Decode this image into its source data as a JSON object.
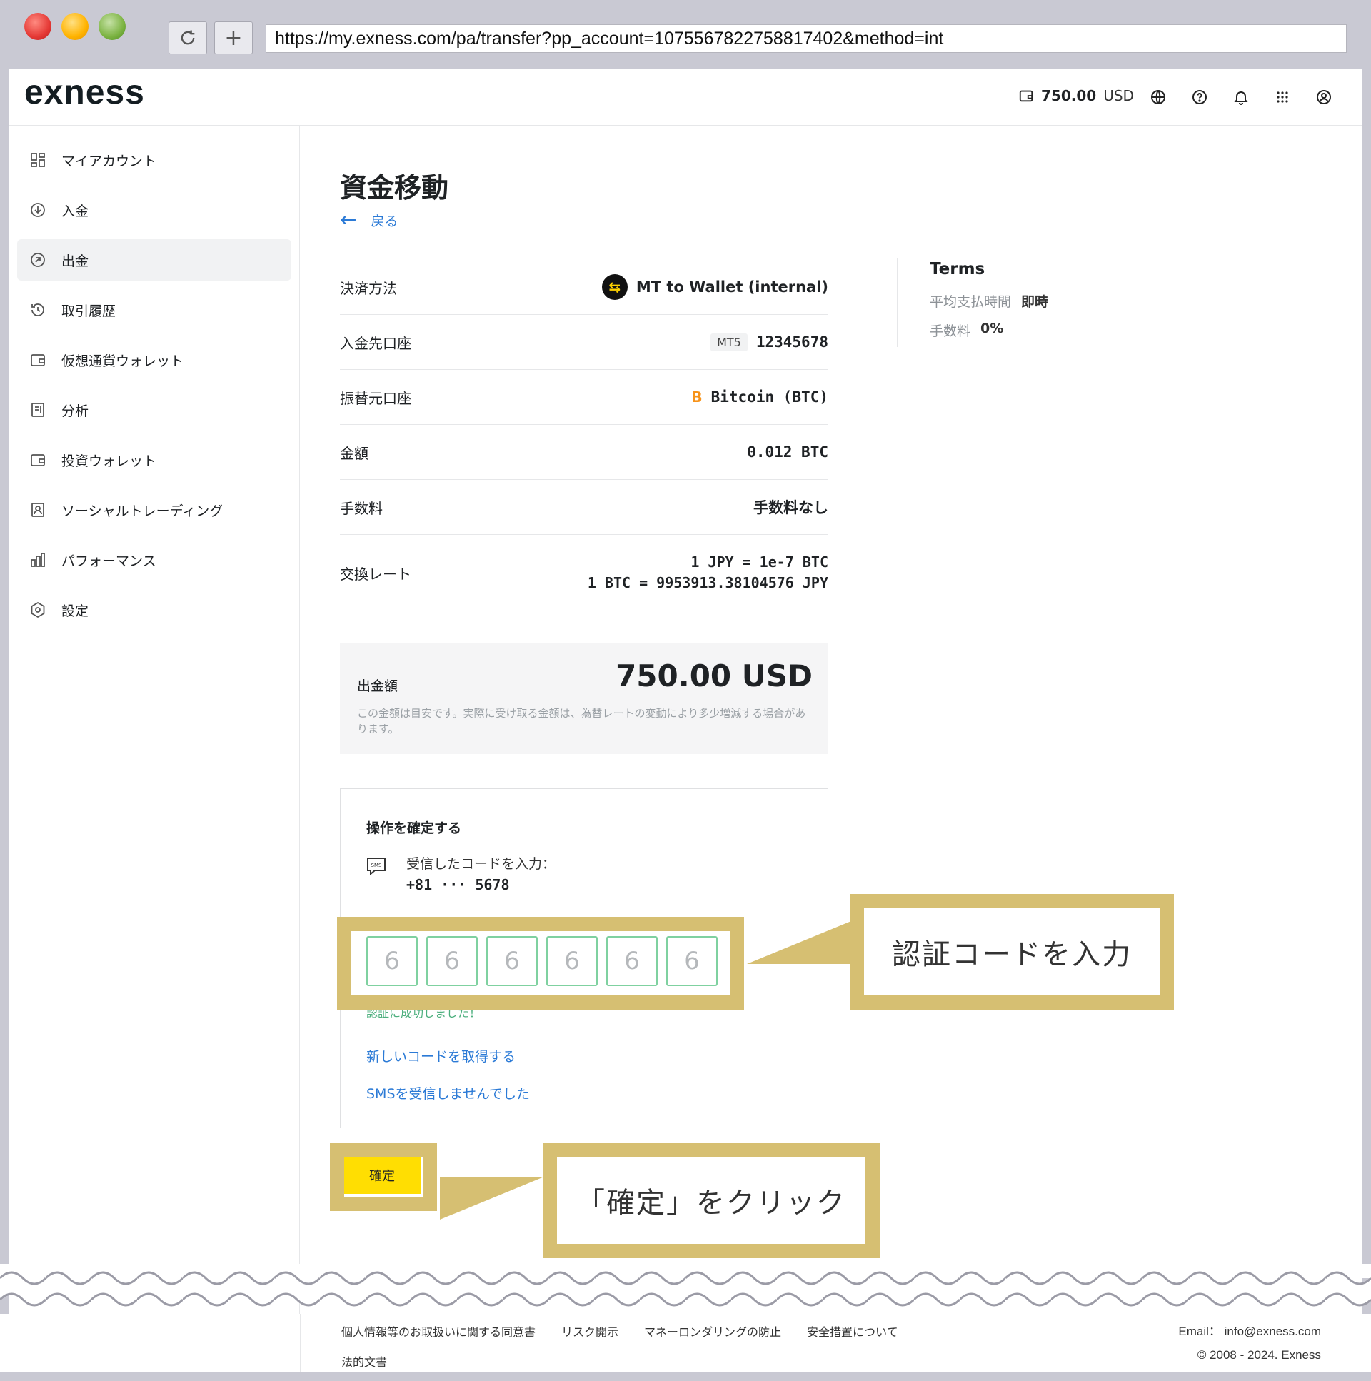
{
  "browser": {
    "url": "https://my.exness.com/pa/transfer?pp_account=107556782275881740​2&method=int"
  },
  "header": {
    "logo": "exness",
    "balance_amount": "750.00",
    "balance_currency": "USD",
    "icons": [
      "wallet-icon",
      "globe-icon",
      "help-icon",
      "bell-icon",
      "apps-grid-icon",
      "user-icon"
    ]
  },
  "sidebar": {
    "items": [
      {
        "label": "マイアカウント",
        "icon": "dashboard-icon"
      },
      {
        "label": "入金",
        "icon": "deposit-icon"
      },
      {
        "label": "出金",
        "icon": "withdraw-icon",
        "active": true
      },
      {
        "label": "取引履歴",
        "icon": "history-icon"
      },
      {
        "label": "仮想通貨ウォレット",
        "icon": "wallet-icon"
      },
      {
        "label": "分析",
        "icon": "analytics-icon"
      },
      {
        "label": "投資ウォレット",
        "icon": "wallet-icon"
      },
      {
        "label": "ソーシャルトレーディング",
        "icon": "social-trading-icon"
      },
      {
        "label": "パフォーマンス",
        "icon": "bar-chart-icon"
      },
      {
        "label": "設定",
        "icon": "settings-icon"
      }
    ]
  },
  "main": {
    "title": "資金移動",
    "back_label": "戻る",
    "rows": {
      "method": {
        "label": "決済方法",
        "value": "MT to Wallet (internal)"
      },
      "to_account": {
        "label": "入金先口座",
        "badge": "MT5",
        "value": "12345678"
      },
      "from_account": {
        "label": "振替元口座",
        "icon_glyph": "B",
        "value": "Bitcoin (BTC)"
      },
      "amount": {
        "label": "金額",
        "value": "0.012 BTC"
      },
      "fee": {
        "label": "手数料",
        "value": "手数料なし"
      },
      "rate": {
        "label": "交換レート",
        "value1": "1 JPY = 1e-7 BTC",
        "value2": "1 BTC = 9953913.38104576 JPY"
      }
    },
    "terms": {
      "heading": "Terms",
      "avg_time_label": "平均支払時間",
      "avg_time_value": "即時",
      "fee_label": "手数料",
      "fee_value": "0%"
    },
    "summary": {
      "label": "出金額",
      "amount": "750.00 USD",
      "note": "この金額は目安です。実際に受け取る金額は、為替レートの変動により多少増減する場合があります。"
    },
    "confirm": {
      "heading": "操作を確定する",
      "sms_badge": "SMS",
      "prompt": "受信したコードを入力：",
      "phone": "+81 ··· 5678",
      "code_digits": [
        "6",
        "6",
        "6",
        "6",
        "6",
        "6"
      ],
      "success": "認証に成功しました！",
      "new_code_link": "新しいコードを取得する",
      "no_sms_link": "SMSを受信しませんでした"
    },
    "confirm_button": "確定"
  },
  "annotations": {
    "code_callout": "認証コードを入力",
    "button_callout": "「確定」をクリック",
    "highlight_color": "#d6bf72"
  },
  "footer": {
    "links": [
      "個人情報等のお取扱いに関する同意書",
      "リスク開示",
      "マネーロンダリングの防止",
      "安全措置について"
    ],
    "legal": "法的文書",
    "email": "Email： info@exness.com",
    "copyright": "© 2008 - 2024. Exness"
  },
  "colors": {
    "accent_yellow": "#ffde02",
    "link_blue": "#2b7ad6",
    "success_green": "#4caf7d"
  }
}
